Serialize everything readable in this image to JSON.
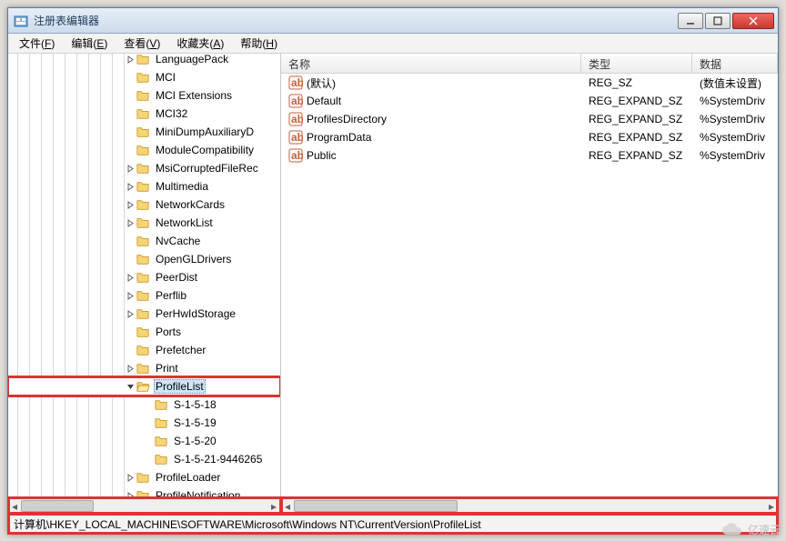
{
  "window": {
    "title": "注册表编辑器"
  },
  "menubar": [
    {
      "label": "文件",
      "hotkey": "F"
    },
    {
      "label": "编辑",
      "hotkey": "E"
    },
    {
      "label": "查看",
      "hotkey": "V"
    },
    {
      "label": "收藏夹",
      "hotkey": "A"
    },
    {
      "label": "帮助",
      "hotkey": "H"
    }
  ],
  "tree_indent_base": 128,
  "tree": [
    {
      "label": "LanguagePack",
      "indent": 128,
      "expander": "closed"
    },
    {
      "label": "MCI",
      "indent": 128,
      "expander": "none"
    },
    {
      "label": "MCI Extensions",
      "indent": 128,
      "expander": "none"
    },
    {
      "label": "MCI32",
      "indent": 128,
      "expander": "none"
    },
    {
      "label": "MiniDumpAuxiliaryD",
      "indent": 128,
      "expander": "none"
    },
    {
      "label": "ModuleCompatibility",
      "indent": 128,
      "expander": "none"
    },
    {
      "label": "MsiCorruptedFileRec",
      "indent": 128,
      "expander": "closed"
    },
    {
      "label": "Multimedia",
      "indent": 128,
      "expander": "closed"
    },
    {
      "label": "NetworkCards",
      "indent": 128,
      "expander": "closed"
    },
    {
      "label": "NetworkList",
      "indent": 128,
      "expander": "closed"
    },
    {
      "label": "NvCache",
      "indent": 128,
      "expander": "none"
    },
    {
      "label": "OpenGLDrivers",
      "indent": 128,
      "expander": "none"
    },
    {
      "label": "PeerDist",
      "indent": 128,
      "expander": "closed"
    },
    {
      "label": "Perflib",
      "indent": 128,
      "expander": "closed"
    },
    {
      "label": "PerHwIdStorage",
      "indent": 128,
      "expander": "closed"
    },
    {
      "label": "Ports",
      "indent": 128,
      "expander": "none"
    },
    {
      "label": "Prefetcher",
      "indent": 128,
      "expander": "none"
    },
    {
      "label": "Print",
      "indent": 128,
      "expander": "closed"
    },
    {
      "label": "ProfileList",
      "indent": 128,
      "expander": "open",
      "selected": true,
      "highlight": true
    },
    {
      "label": "S-1-5-18",
      "indent": 148,
      "expander": "none"
    },
    {
      "label": "S-1-5-19",
      "indent": 148,
      "expander": "none"
    },
    {
      "label": "S-1-5-20",
      "indent": 148,
      "expander": "none"
    },
    {
      "label": "S-1-5-21-9446265",
      "indent": 148,
      "expander": "none"
    },
    {
      "label": "ProfileLoader",
      "indent": 128,
      "expander": "closed"
    },
    {
      "label": "ProfileNotification",
      "indent": 128,
      "expander": "closed"
    }
  ],
  "list": {
    "headers": {
      "name": "名称",
      "type": "类型",
      "data": "数据"
    },
    "rows": [
      {
        "name": "(默认)",
        "type": "REG_SZ",
        "data": "(数值未设置)"
      },
      {
        "name": "Default",
        "type": "REG_EXPAND_SZ",
        "data": "%SystemDriv"
      },
      {
        "name": "ProfilesDirectory",
        "type": "REG_EXPAND_SZ",
        "data": "%SystemDriv"
      },
      {
        "name": "ProgramData",
        "type": "REG_EXPAND_SZ",
        "data": "%SystemDriv"
      },
      {
        "name": "Public",
        "type": "REG_EXPAND_SZ",
        "data": "%SystemDriv"
      }
    ]
  },
  "statusbar": "计算机\\HKEY_LOCAL_MACHINE\\SOFTWARE\\Microsoft\\Windows NT\\CurrentVersion\\ProfileList",
  "watermark": "亿速云"
}
